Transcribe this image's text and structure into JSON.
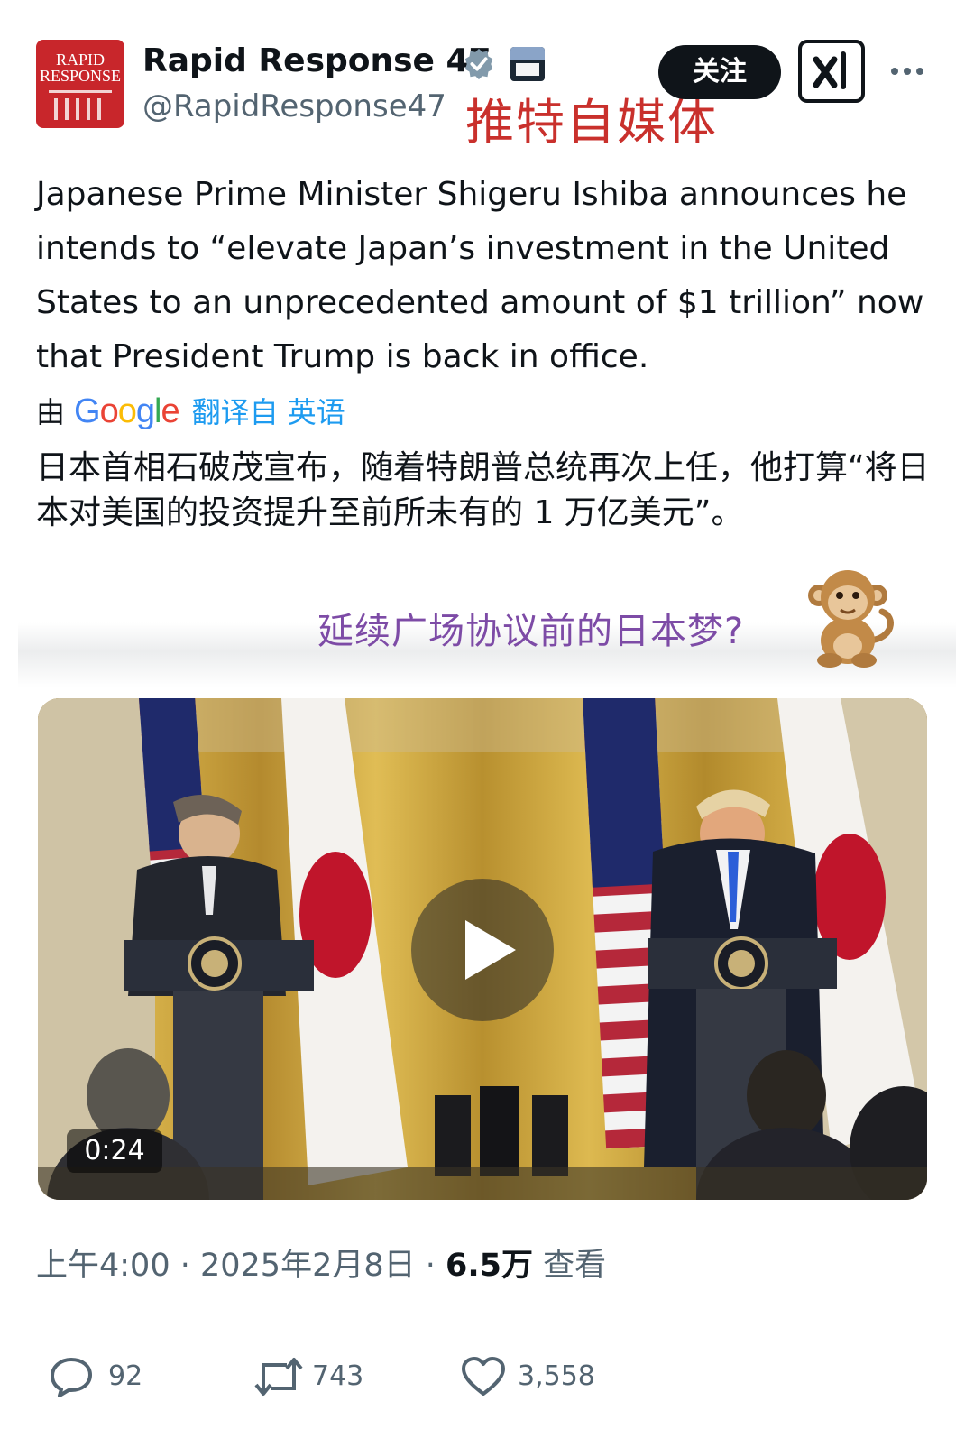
{
  "profile": {
    "avatar_text_line1": "RAPID",
    "avatar_text_line2": "RESPONSE",
    "display_name": "Rapid Response 47",
    "handle": "@RapidResponse47",
    "verified_icon": "verified-badge-icon",
    "affiliation_icon": "white-house-badge-icon"
  },
  "header": {
    "follow_label": "关注",
    "grok_icon": "grok-icon",
    "more_icon": "more-dots-icon"
  },
  "post": {
    "text": "Japanese Prime Minister Shigeru Ishiba announces he intends to “elevate Japan’s investment in the United States to an unprecedented amount of $1 trillion” now that President Trump is back in office.",
    "translation_by": "由",
    "translation_provider": "Google",
    "translation_from": "翻译自 英语",
    "translated_text": "日本首相石破茂宣布，随着特朗普总统再次上任，他打算“将日本对美国的投资提升至前所未有的 1 万亿美元”。"
  },
  "overlays": {
    "red_caption": "推特自媒体",
    "purple_caption": "延续广场协议前的日本梦?",
    "monkey_icon": "monkey-emoji-icon"
  },
  "video": {
    "duration": "0:24",
    "play_icon": "play-icon"
  },
  "meta": {
    "time": "上午4:00",
    "sep1": " · ",
    "date": "2025年2月8日",
    "sep2": " · ",
    "views": "6.5万",
    "views_label": " 查看"
  },
  "actions": {
    "replies": "92",
    "reposts": "743",
    "likes": "3,558"
  },
  "colors": {
    "accent_blue": "#1d9bf0",
    "overlay_red": "#c9302c",
    "overlay_purple": "#7d4ba6",
    "secondary_text": "#536471",
    "avatar_red": "#c8262b"
  }
}
